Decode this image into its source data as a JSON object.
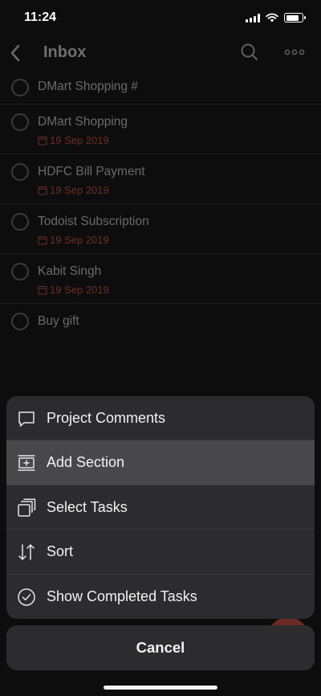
{
  "status_bar": {
    "time": "11:24",
    "icons": [
      "cellular-signal-icon",
      "wifi-icon",
      "battery-icon"
    ],
    "battery_level": 0.8
  },
  "header": {
    "title": "Inbox",
    "icons": [
      "back-chevron-icon",
      "search-icon",
      "more-dots-icon"
    ]
  },
  "tasks": [
    {
      "title": "DMart Shopping #",
      "date": ""
    },
    {
      "title": "DMart Shopping",
      "date": "19 Sep 2019"
    },
    {
      "title": "HDFC Bill Payment",
      "date": "19 Sep 2019"
    },
    {
      "title": "Todoist Subscription",
      "date": "19 Sep 2019"
    },
    {
      "title": "Kabit Singh",
      "date": "19 Sep 2019"
    },
    {
      "title": "Buy gift",
      "date": ""
    }
  ],
  "action_sheet": {
    "items": [
      {
        "label": "Project Comments",
        "icon": "comment-bubble-icon",
        "highlighted": false
      },
      {
        "label": "Add Section",
        "icon": "add-section-icon",
        "highlighted": true
      },
      {
        "label": "Select Tasks",
        "icon": "select-tasks-icon",
        "highlighted": false
      },
      {
        "label": "Sort",
        "icon": "sort-arrows-icon",
        "highlighted": false
      },
      {
        "label": "Show Completed Tasks",
        "icon": "check-circle-icon",
        "highlighted": false
      }
    ],
    "cancel_label": "Cancel"
  },
  "colors": {
    "sheet_background": "#2c2c2e",
    "sheet_highlight": "#48484a",
    "date_text": "#6e2e26",
    "dim_text": "#6a6a6a"
  }
}
